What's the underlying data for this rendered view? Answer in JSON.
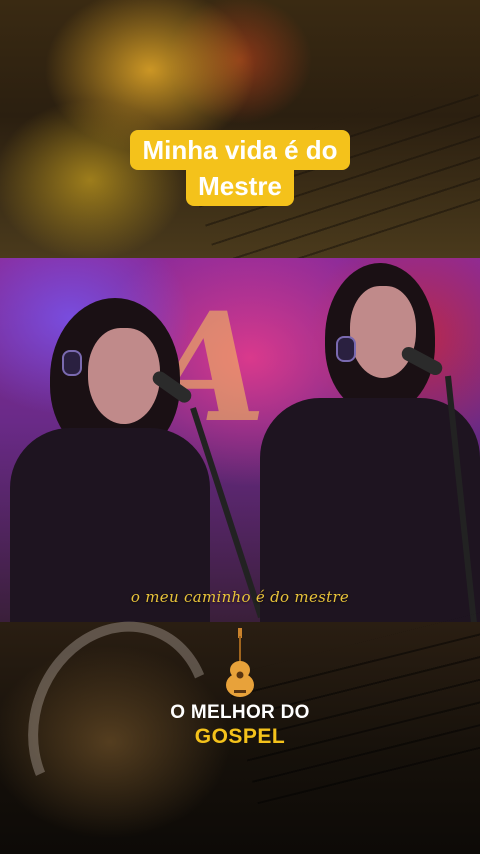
{
  "title": {
    "line1": "Minha vida é do",
    "line2": "Mestre"
  },
  "lyric": "o meu caminho é do mestre",
  "brand": {
    "line1": "O MELHOR DO",
    "line2": "GOSPEL",
    "icon": "guitar-icon"
  },
  "colors": {
    "title_background": "#f4c21b",
    "brand_accent": "#f4c21b",
    "lyric_text": "#e8c33a"
  }
}
